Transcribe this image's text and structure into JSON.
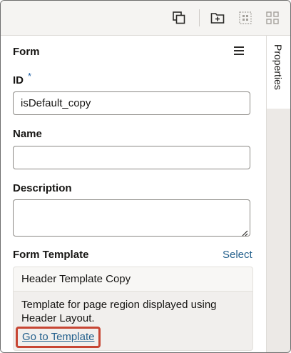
{
  "toolbar": {
    "icons": [
      "duplicate-icon",
      "add-to-folder-icon",
      "grid-select-icon",
      "component-palette-icon"
    ]
  },
  "panel": {
    "title": "Form"
  },
  "fields": {
    "id_label": "ID",
    "id_required": "*",
    "id_value": "isDefault_copy",
    "name_label": "Name",
    "name_value": "",
    "description_label": "Description",
    "description_value": "",
    "form_template_label": "Form Template",
    "select_label": "Select"
  },
  "template": {
    "name": "Header Template Copy",
    "description": "Template for page region displayed using Header Layout.",
    "goto_label": "Go to Template"
  },
  "side_tabs": {
    "properties": "Properties"
  },
  "colors": {
    "link": "#25618d",
    "highlight": "#c74634",
    "required": "#1b5ea4"
  }
}
